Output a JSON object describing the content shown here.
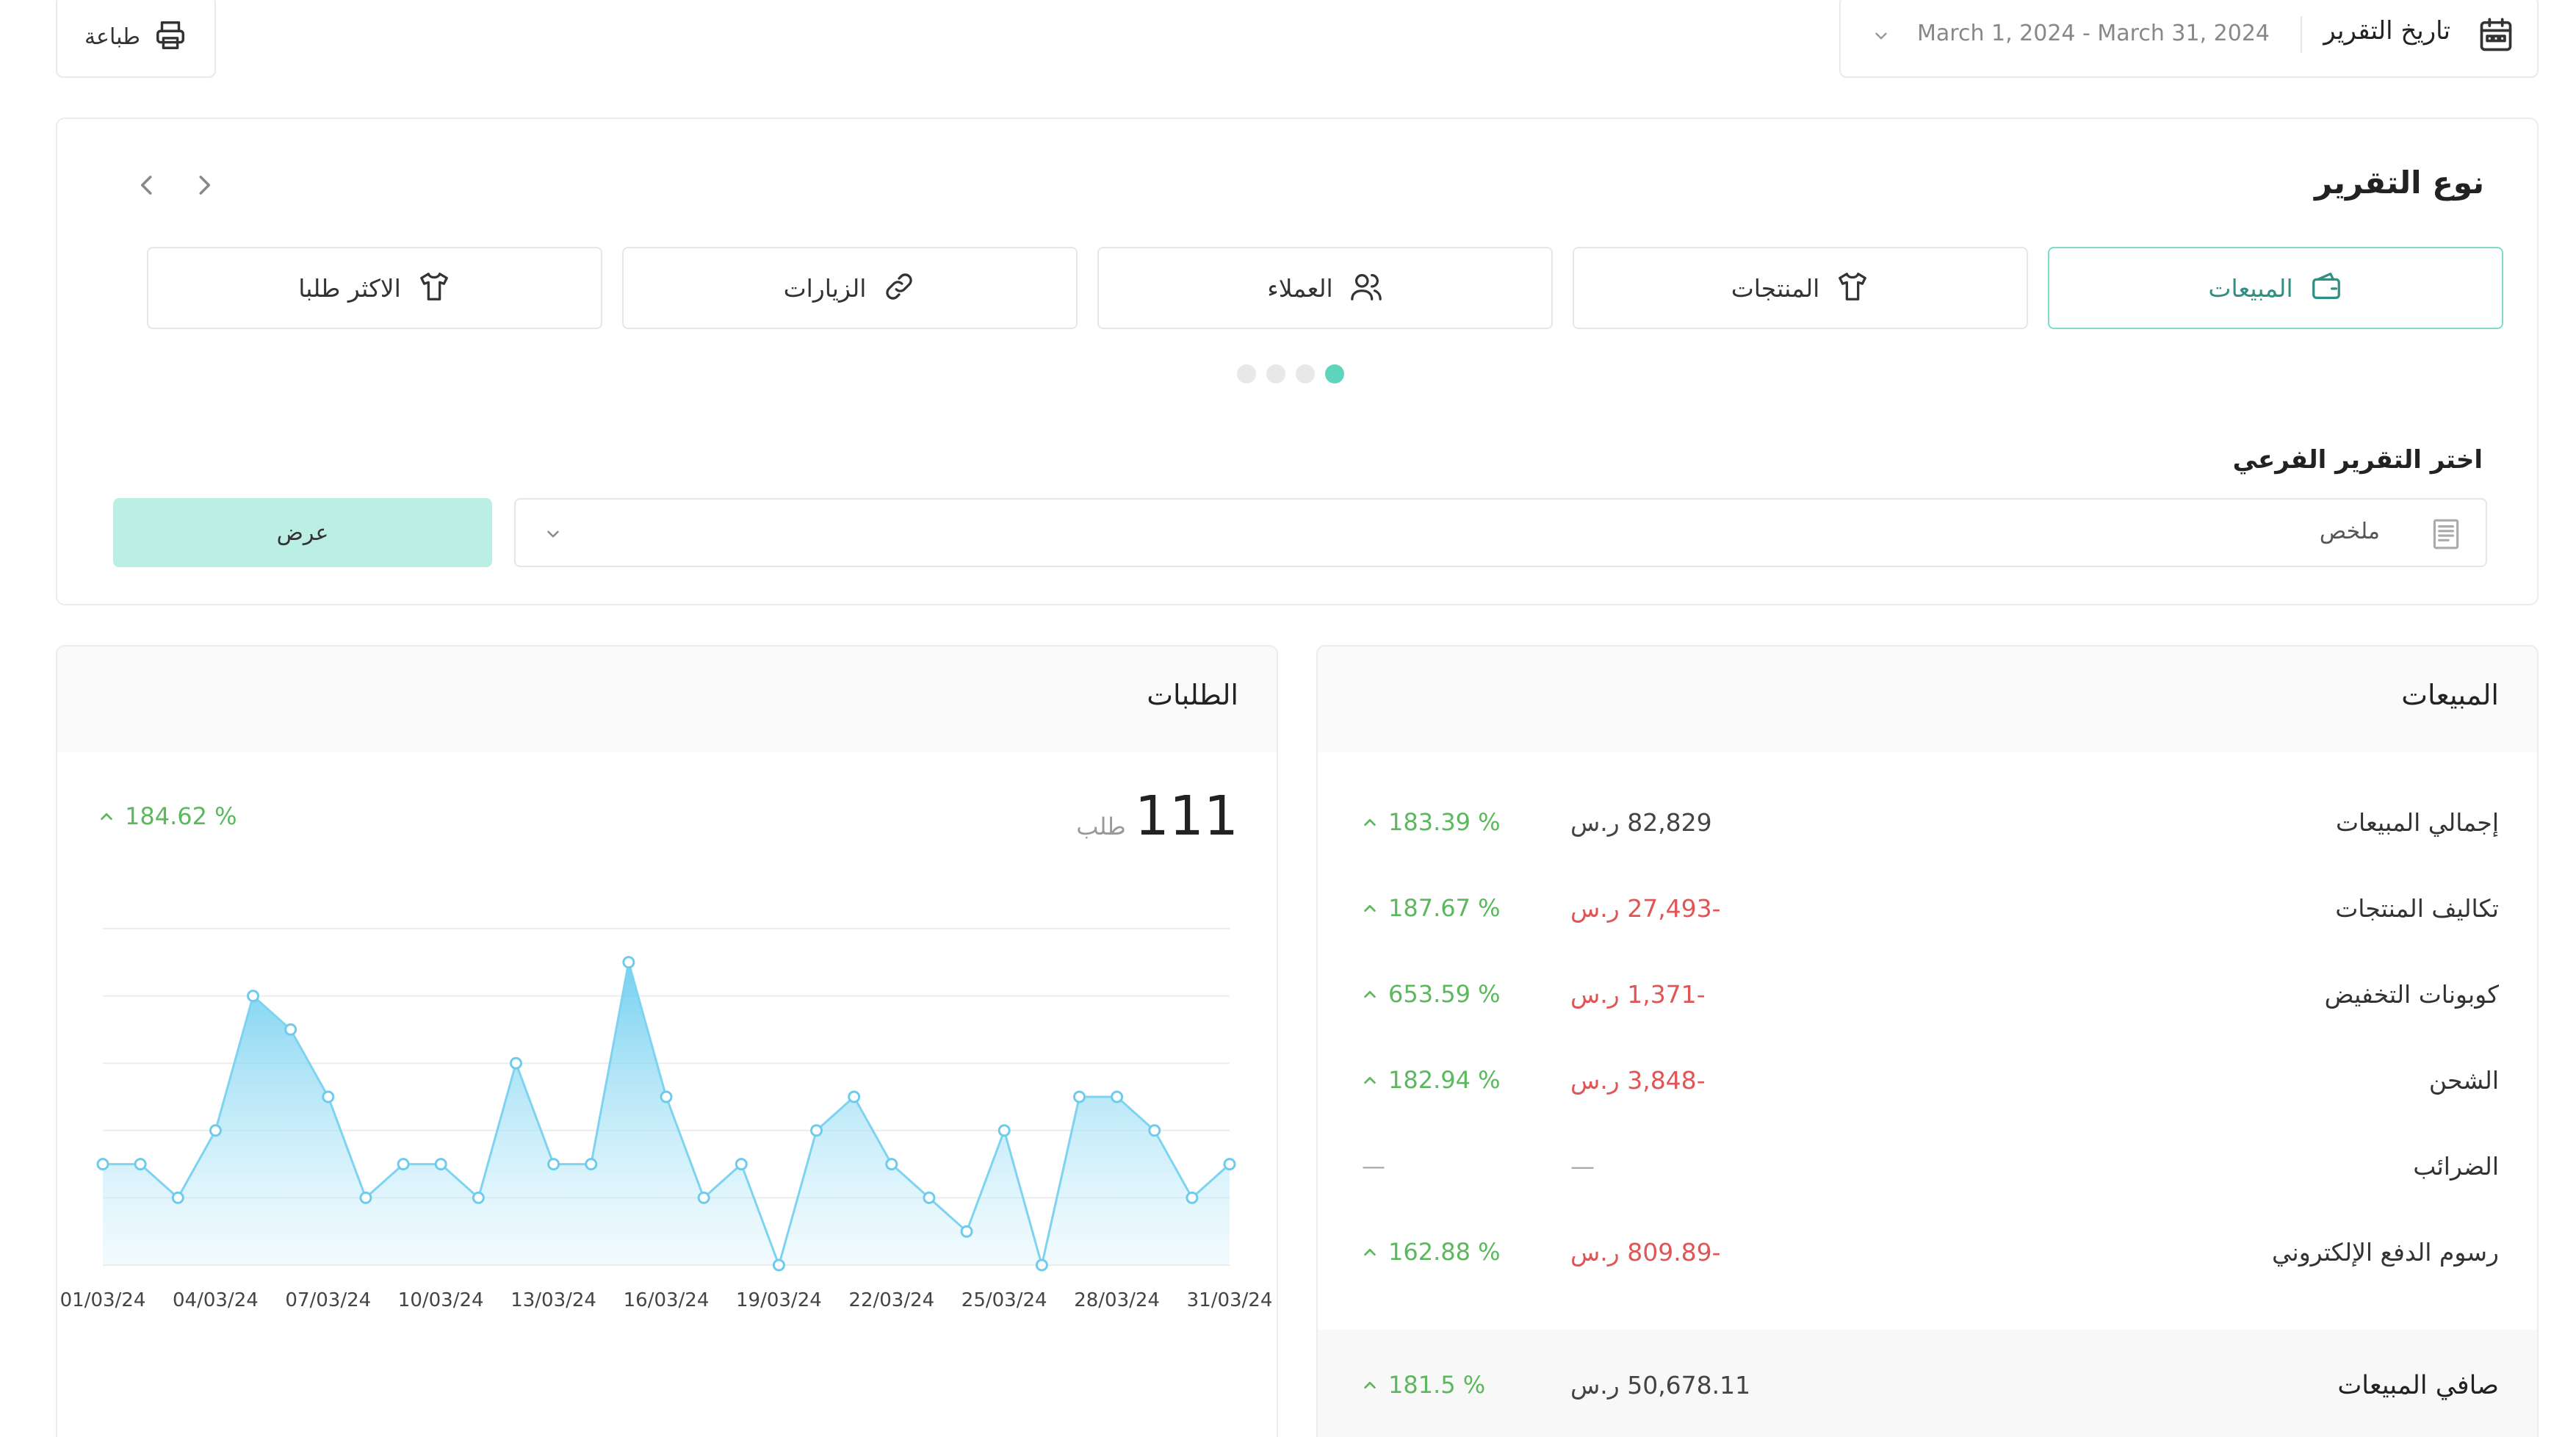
{
  "toolbar": {
    "print_label": "طباعة",
    "report_date_label": "تاريخ التقرير",
    "date_range_value": "March 1, 2024 - March 31, 2024"
  },
  "report_type": {
    "title": "نوع التقرير",
    "types": [
      {
        "label": "المبيعات",
        "icon": "wallet-icon",
        "active": true
      },
      {
        "label": "المنتجات",
        "icon": "tshirt-icon",
        "active": false
      },
      {
        "label": "العملاء",
        "icon": "users-icon",
        "active": false
      },
      {
        "label": "الزيارات",
        "icon": "link-icon",
        "active": false
      },
      {
        "label": "الاكثر طلبا",
        "icon": "tshirt-icon",
        "active": false
      }
    ],
    "page_count": 4,
    "active_page": 1,
    "sub_report_label": "اختر التقرير الفرعي",
    "sub_report_value": "ملخص",
    "show_label": "عرض"
  },
  "orders": {
    "title": "الطلبات",
    "count": "111",
    "count_unit": "طلب",
    "change": "184.62 %"
  },
  "sales": {
    "title": "المبيعات",
    "rows": [
      {
        "name": "إجمالي المبيعات",
        "amount": "82,829 ر.س",
        "negative": false,
        "change": "183.39 %"
      },
      {
        "name": "تكاليف المنتجات",
        "amount": "-27,493 ر.س",
        "negative": true,
        "change": "187.67 %"
      },
      {
        "name": "كوبونات التخفيض",
        "amount": "-1,371 ر.س",
        "negative": true,
        "change": "653.59 %"
      },
      {
        "name": "الشحن",
        "amount": "-3,848 ر.س",
        "negative": true,
        "change": "182.94 %"
      },
      {
        "name": "الضرائب",
        "amount": "—",
        "negative": false,
        "change": "—"
      },
      {
        "name": "رسوم الدفع الإلكتروني",
        "amount": "-809.89 ر.س",
        "negative": true,
        "change": "162.88 %"
      }
    ],
    "net": {
      "name": "صافي المبيعات",
      "amount": "50,678.11 ر.س",
      "change": "181.5 %"
    }
  },
  "colors": {
    "accent": "#5ed4bc",
    "positive": "#5cb85c",
    "negative": "#e05555",
    "chart_line": "#7dd3f0"
  },
  "chart_data": {
    "type": "area",
    "x": [
      "01/03/24",
      "02/03/24",
      "03/03/24",
      "04/03/24",
      "05/03/24",
      "06/03/24",
      "07/03/24",
      "08/03/24",
      "09/03/24",
      "10/03/24",
      "11/03/24",
      "12/03/24",
      "13/03/24",
      "14/03/24",
      "15/03/24",
      "16/03/24",
      "17/03/24",
      "18/03/24",
      "19/03/24",
      "20/03/24",
      "21/03/24",
      "22/03/24",
      "23/03/24",
      "24/03/24",
      "25/03/24",
      "26/03/24",
      "27/03/24",
      "28/03/24",
      "29/03/24",
      "30/03/24",
      "31/03/24"
    ],
    "tick_labels": [
      "01/03/24",
      "04/03/24",
      "07/03/24",
      "10/03/24",
      "13/03/24",
      "16/03/24",
      "19/03/24",
      "22/03/24",
      "25/03/24",
      "28/03/24",
      "31/03/24"
    ],
    "series": [
      {
        "values": [
          3,
          3,
          2,
          4,
          8,
          7,
          5,
          2,
          3,
          3,
          2,
          6,
          3,
          3,
          9,
          5,
          2,
          3,
          0,
          4,
          5,
          3,
          2,
          1,
          4,
          0,
          5,
          5,
          4,
          2,
          3
        ]
      }
    ],
    "ylim": [
      0,
      10
    ],
    "grid": true
  }
}
